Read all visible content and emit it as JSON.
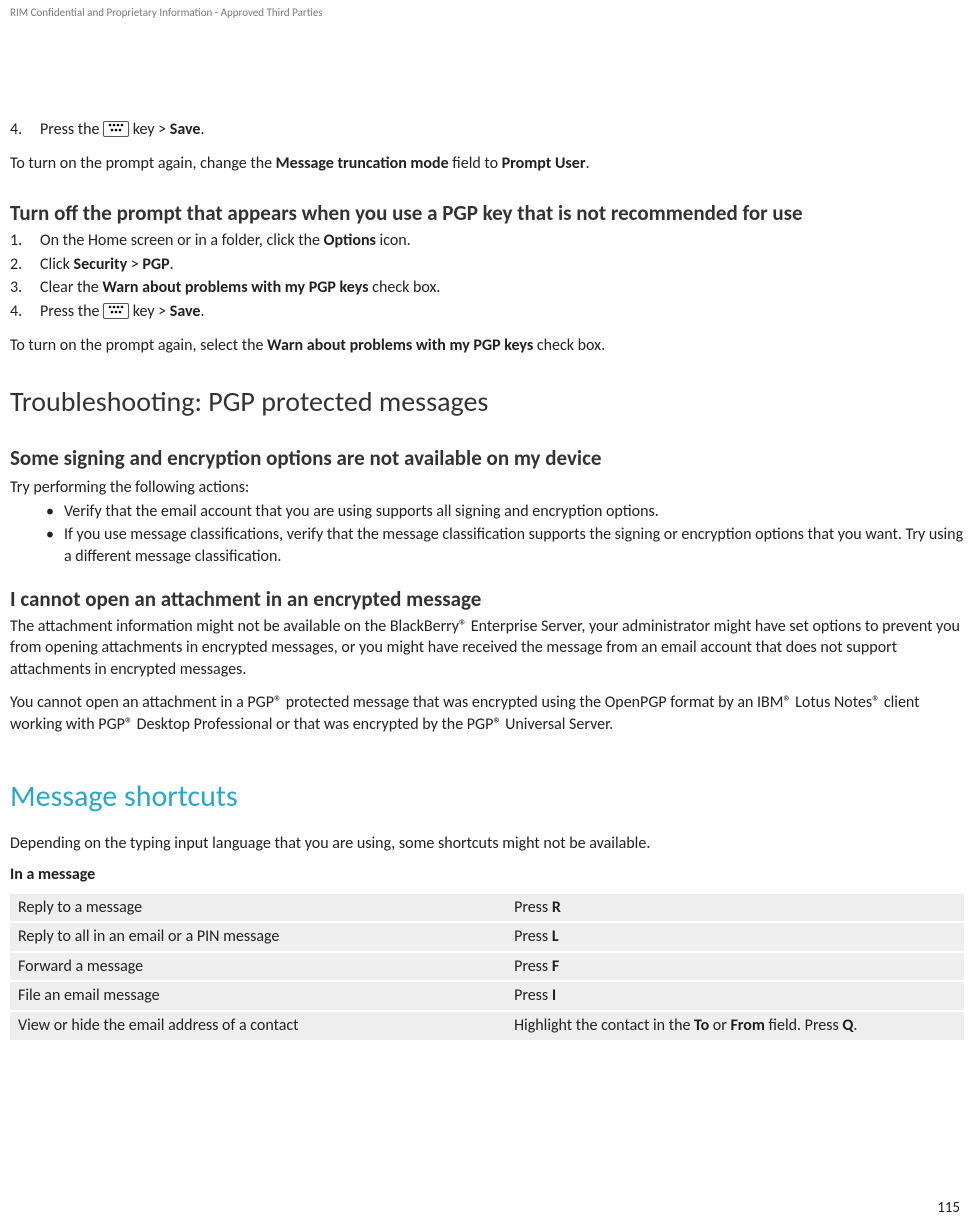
{
  "header": "RIM Confidential and Proprietary Information - Approved Third Parties",
  "topStep": {
    "num": "4.",
    "text_before": "Press the ",
    "text_after": " key > ",
    "save": "Save",
    "period": "."
  },
  "topNote": {
    "pre": "To turn on the prompt again, change the ",
    "b1": "Message truncation mode",
    "mid": " field to ",
    "b2": "Prompt User",
    "post": "."
  },
  "secA": {
    "title": "Turn off the prompt that appears when you use a PGP key that is not recommended for use",
    "steps": [
      {
        "num": "1.",
        "pre": "On the Home screen or in a folder, click the ",
        "b": "Options",
        "post": " icon."
      },
      {
        "num": "2.",
        "pre": "Click ",
        "b": "Security",
        "mid": " > ",
        "b2": "PGP",
        "post": "."
      },
      {
        "num": "3.",
        "pre": "Clear the ",
        "b": "Warn about problems with my PGP keys",
        "post": " check box."
      }
    ],
    "step4": {
      "num": "4.",
      "pre": "Press the ",
      "mid": " key > ",
      "b": "Save",
      "post": "."
    },
    "note": {
      "pre": "To turn on the prompt again, select the ",
      "b": "Warn about problems with my PGP keys",
      "post": " check box."
    }
  },
  "secB": {
    "title": "Troubleshooting: PGP protected messages",
    "sub1": {
      "title": "Some signing and encryption options are not available on my device",
      "lead": "Try performing the following actions:",
      "bullets": [
        "Verify that the email account that you are using supports all signing and encryption options.",
        "If you use message classifications, verify that the message classification supports the signing or encryption options that you want. Try using a different message classification."
      ]
    },
    "sub2": {
      "title": "I cannot open an attachment in an encrypted message",
      "p1": "The attachment information might not be available on the BlackBerry® Enterprise Server, your administrator might have set options to prevent you from opening attachments in encrypted messages, or you might have received the message from an email account that does not support attachments in encrypted messages.",
      "p2": "You cannot open an attachment in a PGP® protected message that was encrypted using the OpenPGP format by an IBM® Lotus Notes® client working with PGP® Desktop Professional or that was encrypted by the PGP® Universal Server."
    }
  },
  "secC": {
    "title": "Message shortcuts",
    "lead": "Depending on the typing input language that you are using, some shortcuts might not be available.",
    "subhead": "In a message",
    "rows": [
      {
        "a": "Reply to a message",
        "b_pre": "Press ",
        "b_b": "R",
        "b_post": ""
      },
      {
        "a": "Reply to all in an email or a PIN message",
        "b_pre": "Press ",
        "b_b": "L",
        "b_post": ""
      },
      {
        "a": "Forward a message",
        "b_pre": "Press ",
        "b_b": "F",
        "b_post": ""
      },
      {
        "a": "File an email message",
        "b_pre": "Press ",
        "b_b": "I",
        "b_post": ""
      },
      {
        "a": "View or hide the email address of a contact",
        "b_pre": "Highlight the contact in the ",
        "b_b": "To",
        "b_mid": " or ",
        "b_b2": "From",
        "b_mid2": " field. Press ",
        "b_b3": "Q",
        "b_post": "."
      }
    ]
  },
  "pageNum": "115"
}
